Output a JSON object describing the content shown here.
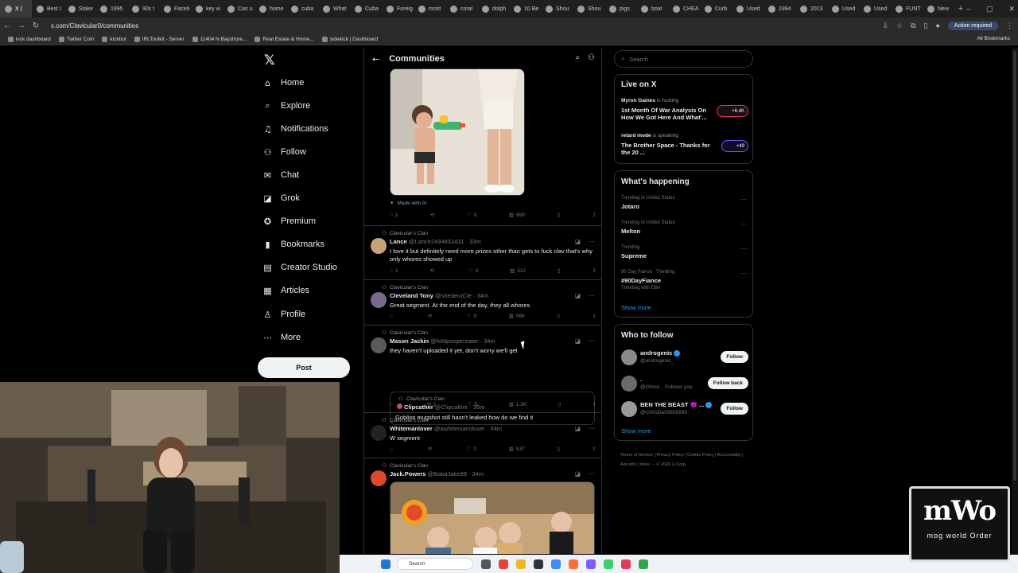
{
  "browser": {
    "tabs": [
      {
        "label": "X (",
        "active": true
      },
      {
        "label": "Best I"
      },
      {
        "label": "Stake"
      },
      {
        "label": "1995"
      },
      {
        "label": "90s t"
      },
      {
        "label": "Faceb"
      },
      {
        "label": "key w"
      },
      {
        "label": "Can u"
      },
      {
        "label": "home"
      },
      {
        "label": "cuba"
      },
      {
        "label": "What"
      },
      {
        "label": "Cuba"
      },
      {
        "label": "Foreig"
      },
      {
        "label": "most"
      },
      {
        "label": "coral"
      },
      {
        "label": "dolph"
      },
      {
        "label": "10 Be"
      },
      {
        "label": "Shou"
      },
      {
        "label": "Shou"
      },
      {
        "label": "pigs"
      },
      {
        "label": "boat"
      },
      {
        "label": "CHEA"
      },
      {
        "label": "Curb"
      },
      {
        "label": "Used"
      },
      {
        "label": "1994"
      },
      {
        "label": "2013"
      },
      {
        "label": "Used"
      },
      {
        "label": "Used"
      },
      {
        "label": "FUNT"
      },
      {
        "label": "New"
      }
    ],
    "new_tab": "+",
    "url": "x.com/Clavicular0/communities",
    "action_required": "Action required",
    "bookmarks": [
      {
        "label": "kick dashboard"
      },
      {
        "label": "Twitter Com"
      },
      {
        "label": "kickbot"
      },
      {
        "label": "IRLToolkit - Server"
      },
      {
        "label": "11404 N Bayshore..."
      },
      {
        "label": "Real Estate & Home..."
      },
      {
        "label": "sidekick | Dashboard"
      }
    ],
    "all_bookmarks": "All Bookmarks"
  },
  "nav": {
    "items": [
      {
        "label": "Home",
        "icon": "⌂"
      },
      {
        "label": "Explore",
        "icon": "⌕"
      },
      {
        "label": "Notifications",
        "icon": "♫"
      },
      {
        "label": "Follow",
        "icon": "⚇"
      },
      {
        "label": "Chat",
        "icon": "✉"
      },
      {
        "label": "Grok",
        "icon": "◪"
      },
      {
        "label": "Premium",
        "icon": "✪"
      },
      {
        "label": "Bookmarks",
        "icon": "▮"
      },
      {
        "label": "Creator Studio",
        "icon": "▤"
      },
      {
        "label": "Articles",
        "icon": "▦"
      },
      {
        "label": "Profile",
        "icon": "♙"
      },
      {
        "label": "More",
        "icon": "⋯"
      }
    ],
    "post_button": "Post"
  },
  "feed": {
    "title": "Communities",
    "ai_label": "Made with AI",
    "first_actions": {
      "reply": "1",
      "repost": "",
      "like": "5",
      "views": "699"
    },
    "posts": [
      {
        "community": "Clavicular's Clan",
        "name": "Lance",
        "handle": "@Lance2494932431 · 33m",
        "text": "I love it but definitely need more prizes other than gets to fuck clav that's why only whores showed up",
        "reply": "1",
        "repost": "",
        "like": "3",
        "views": "512"
      },
      {
        "community": "Clavicular's Clan",
        "name": "Cleveland Tony",
        "handle": "@shedeurCle · 34m",
        "text": "Great segment. At the end of the day, they all whores",
        "reply": "",
        "repost": "",
        "like": "9",
        "views": "568"
      },
      {
        "community": "Clavicular's Clan",
        "name": "Mason Jackin",
        "handle": "@foldpoopereater · 34m",
        "text": "they haven't uploaded it yet, don't worry we'll get",
        "quote": {
          "community": "Clavicular's Clan",
          "name": "Clipcather",
          "handle": "@Clipcather · 35m",
          "text": "Goblins mugshot still hasn't leaked how do we find it"
        },
        "reply": "",
        "repost": "1",
        "like": "5",
        "views": "1.2K"
      },
      {
        "community": "Clavicular's Clan",
        "name": "Whitemanlover",
        "handle": "@awhitemanslover · 34m",
        "text": "W segment",
        "reply": "",
        "repost": "",
        "like": "2",
        "views": "537"
      },
      {
        "community": "Clavicular's Clan",
        "name": "Jack.Powers",
        "handle": "@BabaJake99 · 34m",
        "text": ""
      }
    ]
  },
  "right": {
    "search_placeholder": "Search",
    "live_title": "Live on X",
    "live": [
      {
        "host": "Myron Gaines",
        "status": "is hosting",
        "title": "1st Month Of War Analysis On How We Got Here And What'...",
        "count": "+6.4K"
      },
      {
        "host": "retard mode",
        "status": "is speaking",
        "title": "The Brother Space - Thanks for the 20 ...",
        "count": "+49"
      }
    ],
    "happening_title": "What's happening",
    "trends": [
      {
        "context": "Trending in United States",
        "name": "Jotaro"
      },
      {
        "context": "Trending in United States",
        "name": "Melton"
      },
      {
        "context": "Trending",
        "name": "Supreme"
      },
      {
        "context": "90 Day Fiancé · Trending",
        "name": "#90DayFiance",
        "sub": "Trending with Ellie"
      }
    ],
    "show_more": "Show more",
    "wtf_title": "Who to follow",
    "wtf": [
      {
        "name": "androgenic",
        "handle": "@androgenic_",
        "button": "Follow"
      },
      {
        "name": ".",
        "handle": "@Ottost...  Follows you",
        "button": "Follow back"
      },
      {
        "name": "BEN THE BEAST 😈 ...",
        "handle": "@ChrisDa05695895",
        "button": "Follow"
      }
    ],
    "show_more_2": "Show more",
    "footer": "Terms of Service  |  Privacy Policy  |  Cookie Policy  |  Accessibility  |  Ads info  |  More ···  © 2026 X Corp."
  },
  "overlay": {
    "logo_letters": "mWo",
    "logo_text": "mog world Order"
  },
  "taskbar": {
    "search": "Search"
  }
}
